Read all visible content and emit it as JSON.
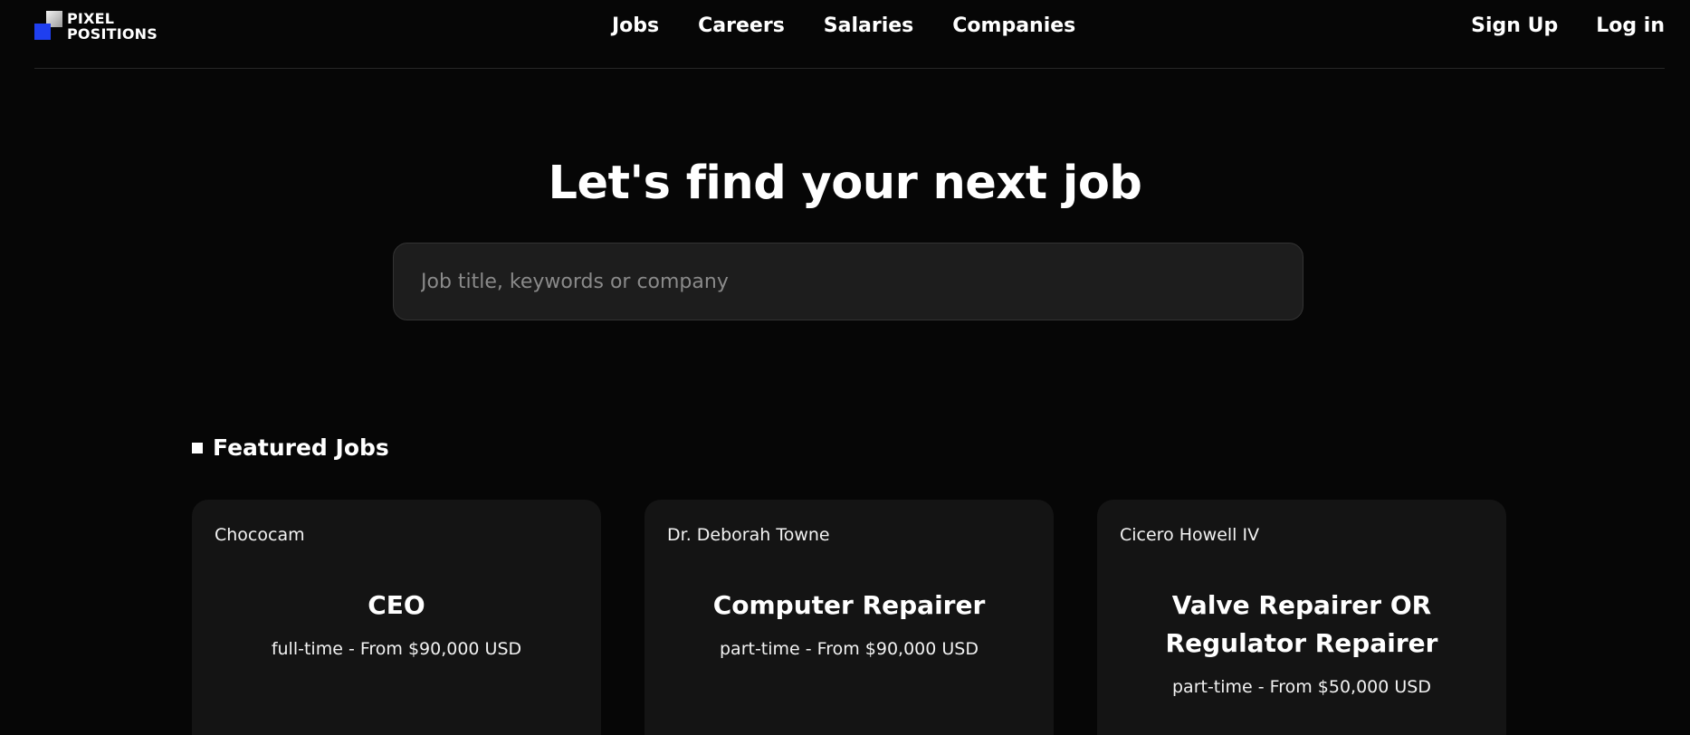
{
  "brand": {
    "line1": "PIXEL",
    "line2": "POSITIONS"
  },
  "nav": [
    {
      "label": "Jobs"
    },
    {
      "label": "Careers"
    },
    {
      "label": "Salaries"
    },
    {
      "label": "Companies"
    }
  ],
  "auth": {
    "signup": "Sign Up",
    "login": "Log in"
  },
  "hero": {
    "title": "Let's find your next job",
    "search_placeholder": "Job title, keywords or company"
  },
  "featured": {
    "heading": "Featured Jobs",
    "jobs": [
      {
        "company": "Chococam",
        "title": "CEO",
        "meta": "full-time - From $90,000 USD"
      },
      {
        "company": "Dr. Deborah Towne",
        "title": "Computer Repairer",
        "meta": "part-time - From $90,000 USD"
      },
      {
        "company": "Cicero Howell IV",
        "title": "Valve Repairer OR Regulator Repairer",
        "meta": "part-time - From $50,000 USD"
      }
    ]
  },
  "colors": {
    "background": "#060606",
    "card": "#141414",
    "search_bg": "#1d1d1d",
    "logo_blue": "#1f3ff0"
  }
}
